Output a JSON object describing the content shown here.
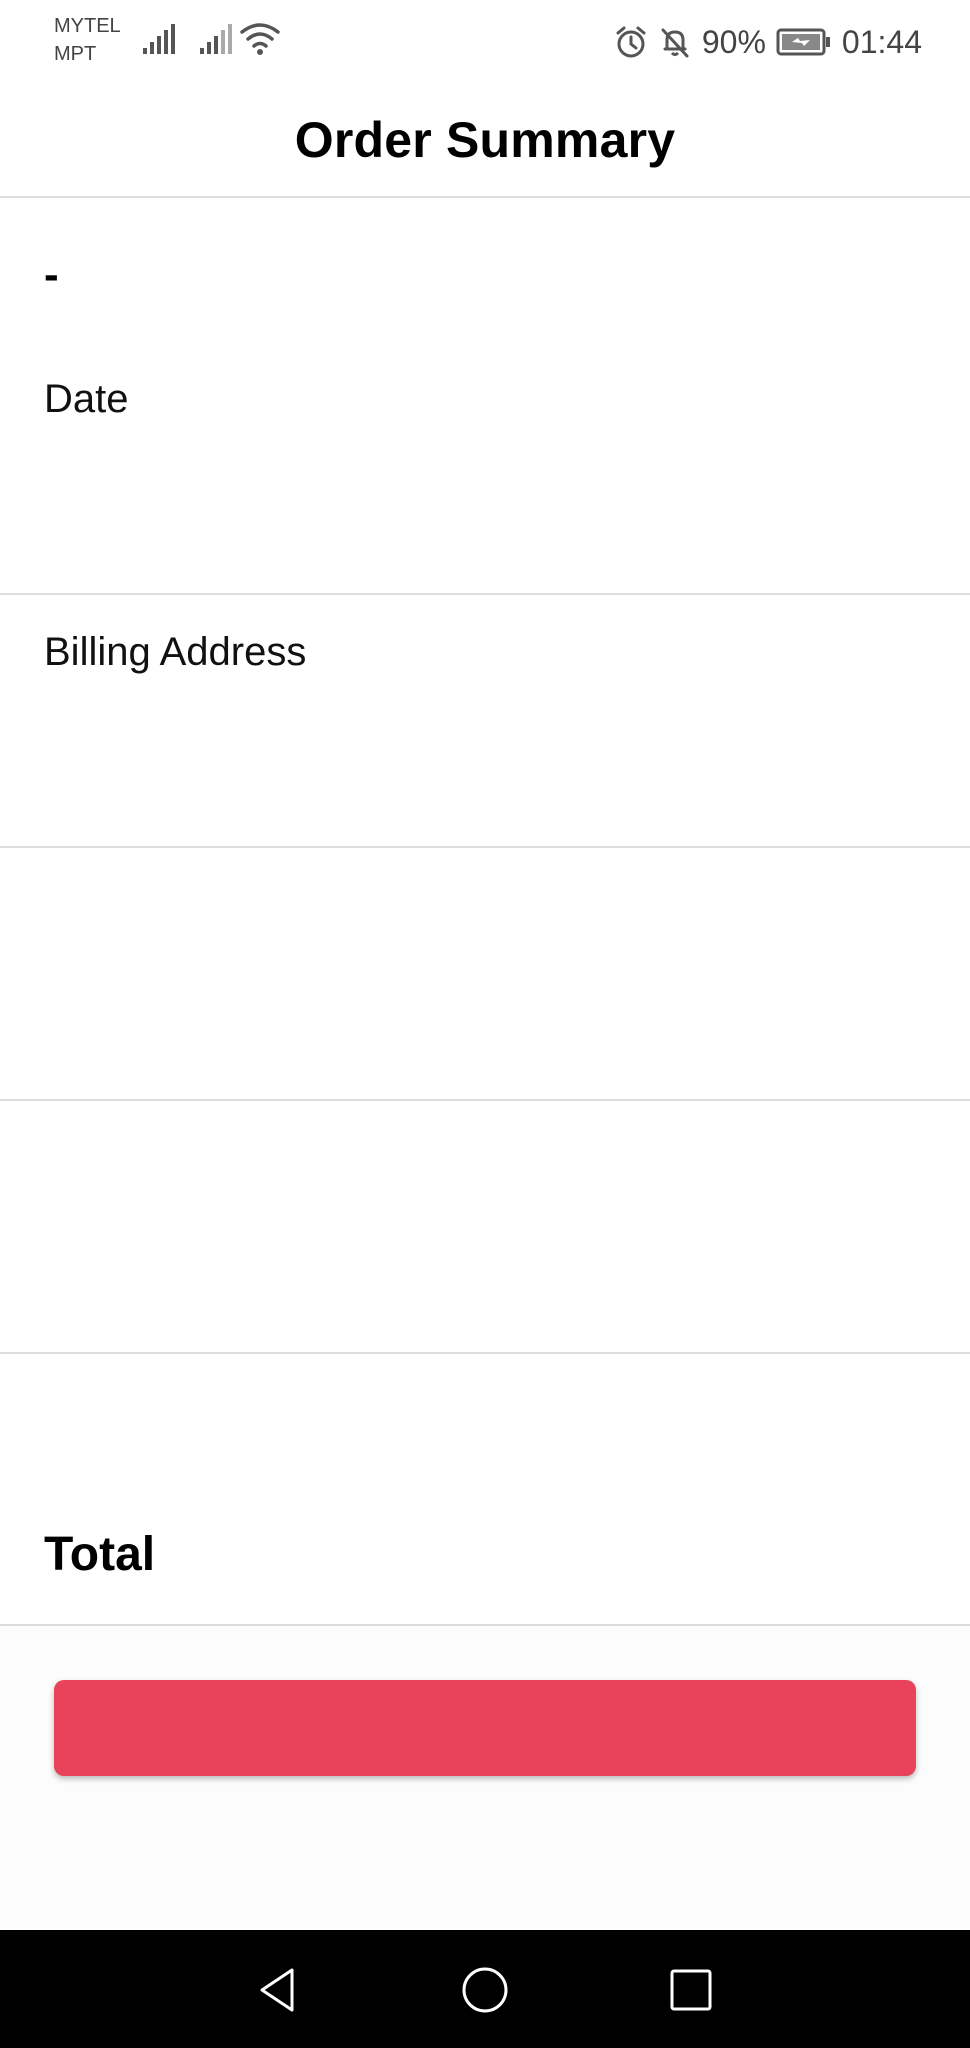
{
  "status_bar": {
    "carrier_1": "MYTEL",
    "carrier_2": "MPT",
    "battery_percent": "90%",
    "time": "01:44",
    "icons": [
      "signal-icon",
      "signal-icon",
      "wifi-icon",
      "alarm-icon",
      "bell-off-icon",
      "battery-charging-icon"
    ]
  },
  "header": {
    "title": "Order Summary"
  },
  "order": {
    "number": "-",
    "date_label": "Date",
    "billing_address_label": "Billing Address",
    "total_label": "Total"
  },
  "checkout_button": {
    "label": "",
    "color": "#e8435a"
  },
  "nav_bar": {
    "icons": [
      "back-icon",
      "home-icon",
      "recent-apps-icon"
    ]
  }
}
